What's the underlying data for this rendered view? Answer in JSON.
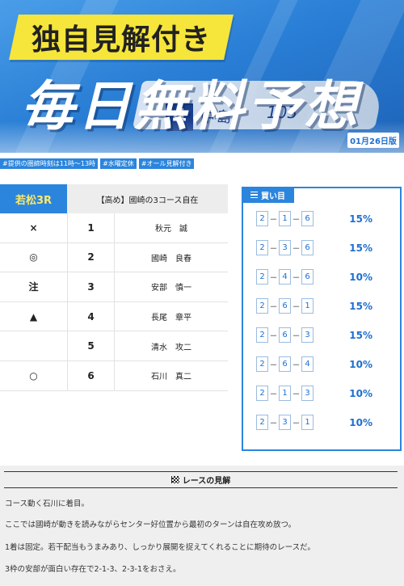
{
  "banner": {
    "badge": "独自見解付き",
    "headline": "毎日無料予想",
    "boat_number": "4",
    "boat_name": "中島",
    "boat_code": "103",
    "date": "01月26日版"
  },
  "tags": [
    "#提供の圏締時刻は11時〜13時",
    "#水曜定休",
    "#オール見解付き"
  ],
  "race": {
    "name": "若松3R",
    "title": "【高め】國崎の3コース自在",
    "rows": [
      {
        "mark": "×",
        "lane": "1",
        "racer": "秋元　誠"
      },
      {
        "mark": "◎",
        "lane": "2",
        "racer": "國崎　良春"
      },
      {
        "mark": "注",
        "lane": "3",
        "racer": "安部　慎一"
      },
      {
        "mark": "▲",
        "lane": "4",
        "racer": "長尾　章平"
      },
      {
        "mark": "",
        "lane": "5",
        "racer": "清水　攻二"
      },
      {
        "mark": "○",
        "lane": "6",
        "racer": "石川　真二"
      }
    ]
  },
  "picks": {
    "title": "買い目",
    "icon": "list-icon",
    "dash": "－",
    "rows": [
      {
        "n": [
          "2",
          "1",
          "6"
        ],
        "pct": "15%"
      },
      {
        "n": [
          "2",
          "3",
          "6"
        ],
        "pct": "15%"
      },
      {
        "n": [
          "2",
          "4",
          "6"
        ],
        "pct": "10%"
      },
      {
        "n": [
          "2",
          "6",
          "1"
        ],
        "pct": "15%"
      },
      {
        "n": [
          "2",
          "6",
          "3"
        ],
        "pct": "15%"
      },
      {
        "n": [
          "2",
          "6",
          "4"
        ],
        "pct": "10%"
      },
      {
        "n": [
          "2",
          "1",
          "3"
        ],
        "pct": "10%"
      },
      {
        "n": [
          "2",
          "3",
          "1"
        ],
        "pct": "10%"
      }
    ]
  },
  "commentary": {
    "title": "レースの見解",
    "icon": "checkered-flag-icon",
    "lines": [
      "コース動く石川に着目。",
      "ここでは國崎が動きを読みながらセンター好位置から最初のターンは自在攻め放つ。",
      "1着は固定。若干配当もうまみあり、しっかり展開を捉えてくれることに期待のレースだ。",
      "3枠の安部が面白い存在で2-1-3、2-3-1をおさえ。"
    ]
  },
  "colors": {
    "accent": "#2b85dd",
    "race_name_text": "#fbe96a",
    "badge": "#f6e53a"
  }
}
